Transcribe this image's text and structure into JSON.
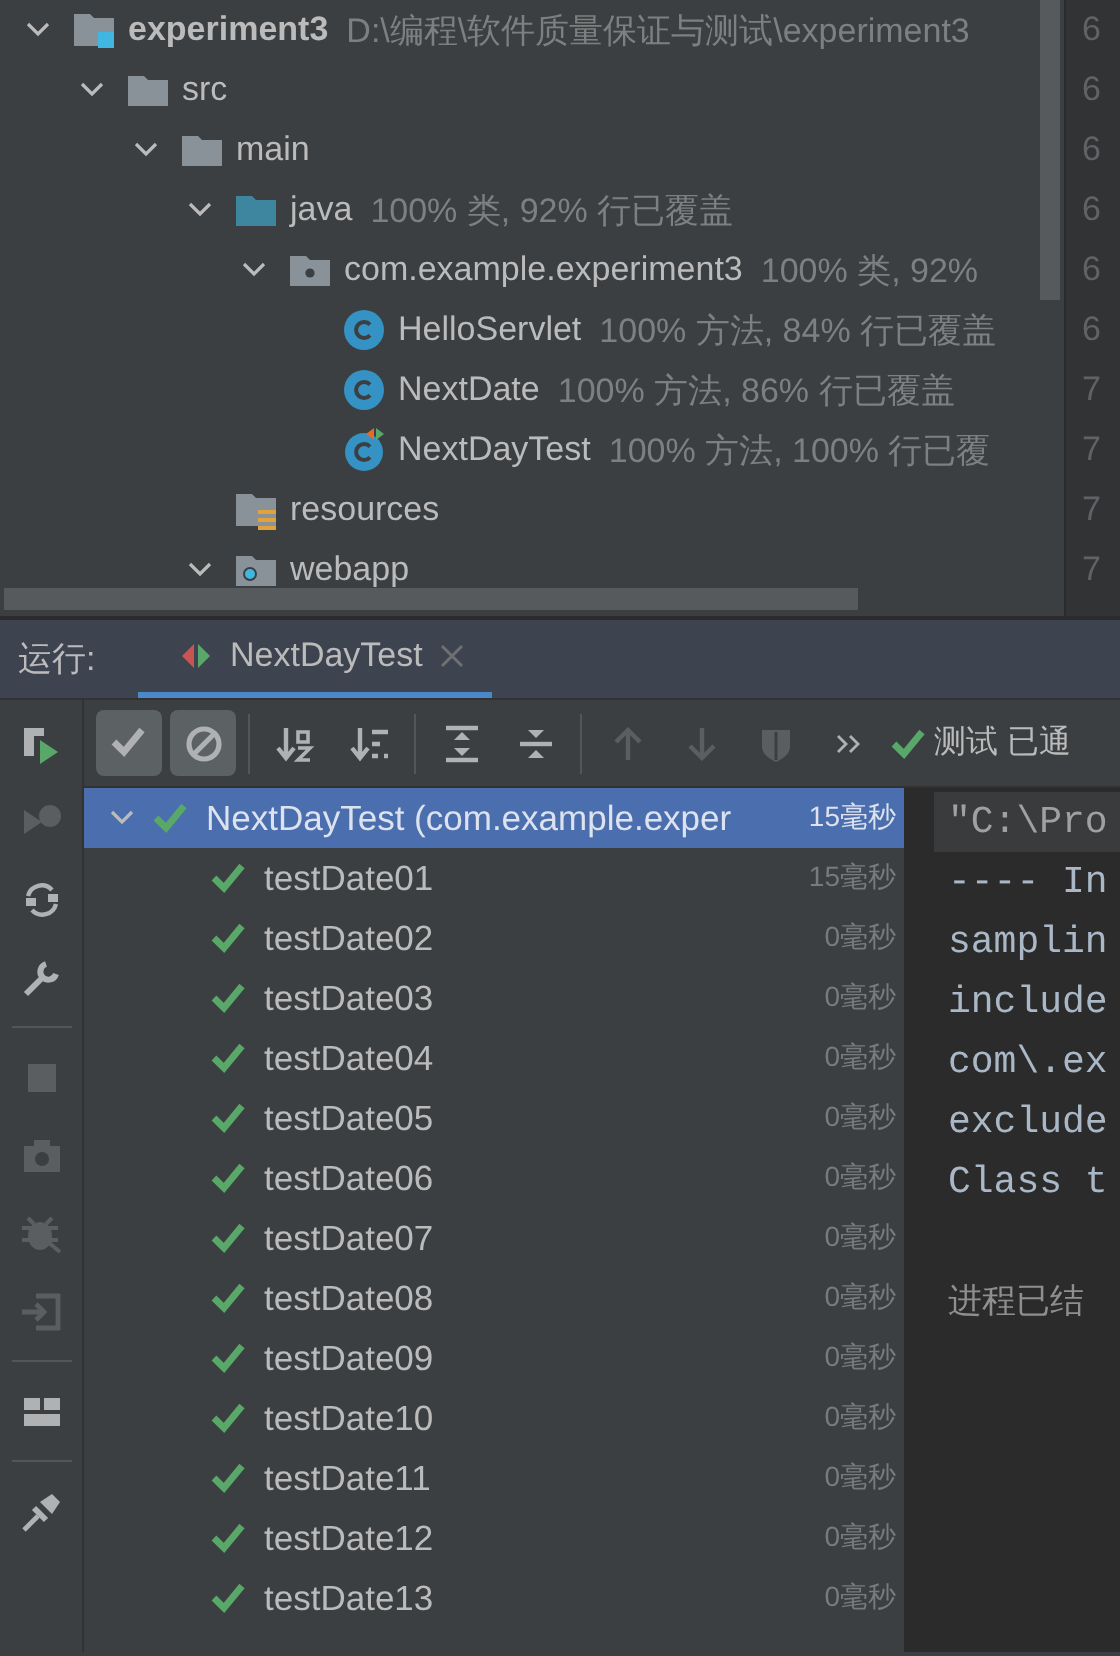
{
  "project_tree": {
    "items": [
      {
        "label": "experiment3",
        "detail": "D:\\编程\\软件质量保证与测试\\experiment3",
        "kind": "module",
        "expanded": true,
        "children": [
          {
            "label": "src",
            "kind": "folder",
            "expanded": true,
            "children": [
              {
                "label": "main",
                "kind": "folder",
                "expanded": true,
                "children": [
                  {
                    "label": "java",
                    "detail": "100% 类, 92% 行已覆盖",
                    "kind": "source-folder",
                    "expanded": true,
                    "children": [
                      {
                        "label": "com.example.experiment3",
                        "detail": "100% 类, 92%",
                        "kind": "package",
                        "expanded": true,
                        "children": [
                          {
                            "label": "HelloServlet",
                            "detail": "100% 方法, 84% 行已覆盖",
                            "kind": "class"
                          },
                          {
                            "label": "NextDate",
                            "detail": "100% 方法, 86% 行已覆盖",
                            "kind": "class"
                          },
                          {
                            "label": "NextDayTest",
                            "detail": "100% 方法, 100% 行已覆",
                            "kind": "test-class"
                          }
                        ]
                      }
                    ]
                  },
                  {
                    "label": "resources",
                    "kind": "resources-folder"
                  },
                  {
                    "label": "webapp",
                    "kind": "web-folder",
                    "expanded": true
                  }
                ]
              }
            ]
          }
        ]
      }
    ],
    "line_numbers": [
      "6",
      "6",
      "6",
      "6",
      "6",
      "6",
      "7",
      "7",
      "7",
      "7"
    ]
  },
  "run_panel": {
    "label": "运行:",
    "tabs": [
      {
        "label": "NextDayTest",
        "selected": true
      }
    ],
    "side_tools": [
      {
        "kind": "rerun",
        "disabled": false
      },
      {
        "kind": "rerun-failed",
        "disabled": true
      },
      {
        "kind": "auto-rerun",
        "disabled": false
      },
      {
        "kind": "settings",
        "disabled": false
      },
      {
        "kind": "divider"
      },
      {
        "kind": "stop",
        "disabled": true
      },
      {
        "kind": "camera",
        "disabled": true
      },
      {
        "kind": "debug",
        "disabled": true
      },
      {
        "kind": "exit",
        "disabled": true
      },
      {
        "kind": "divider"
      },
      {
        "kind": "layout",
        "disabled": false
      },
      {
        "kind": "divider"
      },
      {
        "kind": "pin",
        "disabled": false
      }
    ],
    "toolbar": [
      {
        "kind": "show-passed",
        "on": true
      },
      {
        "kind": "show-ignored",
        "on": true
      },
      {
        "kind": "divider"
      },
      {
        "kind": "sort-alpha",
        "on": false
      },
      {
        "kind": "sort-duration",
        "on": false
      },
      {
        "kind": "divider"
      },
      {
        "kind": "expand-all",
        "on": false
      },
      {
        "kind": "collapse-all",
        "on": false
      },
      {
        "kind": "divider"
      },
      {
        "kind": "previous",
        "disabled": true
      },
      {
        "kind": "next",
        "disabled": true
      },
      {
        "kind": "coverage",
        "disabled": true
      },
      {
        "kind": "more"
      }
    ],
    "status": "测试 已通",
    "tests": [
      {
        "label": "NextDayTest (com.example.exper",
        "time": "15毫秒",
        "passed": true,
        "selected": true,
        "expanded": true,
        "children": [
          {
            "label": "testDate01",
            "time": "15毫秒",
            "passed": true,
            "selected": false
          },
          {
            "label": "testDate02",
            "time": "0毫秒",
            "passed": true,
            "selected": false
          },
          {
            "label": "testDate03",
            "time": "0毫秒",
            "passed": true,
            "selected": false
          },
          {
            "label": "testDate04",
            "time": "0毫秒",
            "passed": true,
            "selected": false
          },
          {
            "label": "testDate05",
            "time": "0毫秒",
            "passed": true,
            "selected": false
          },
          {
            "label": "testDate06",
            "time": "0毫秒",
            "passed": true,
            "selected": false
          },
          {
            "label": "testDate07",
            "time": "0毫秒",
            "passed": true,
            "selected": false
          },
          {
            "label": "testDate08",
            "time": "0毫秒",
            "passed": true,
            "selected": false
          },
          {
            "label": "testDate09",
            "time": "0毫秒",
            "passed": true,
            "selected": false
          },
          {
            "label": "testDate10",
            "time": "0毫秒",
            "passed": true,
            "selected": false
          },
          {
            "label": "testDate11",
            "time": "0毫秒",
            "passed": true,
            "selected": false
          },
          {
            "label": "testDate12",
            "time": "0毫秒",
            "passed": true,
            "selected": false
          },
          {
            "label": "testDate13",
            "time": "0毫秒",
            "passed": true,
            "selected": false
          }
        ]
      }
    ],
    "console": [
      {
        "kind": "command",
        "text": "\"C:\\Pro"
      },
      {
        "kind": "output",
        "text": "---- In"
      },
      {
        "kind": "output",
        "text": "samplin"
      },
      {
        "kind": "output",
        "text": "include"
      },
      {
        "kind": "output",
        "text": "com\\.ex"
      },
      {
        "kind": "output",
        "text": "exclude"
      },
      {
        "kind": "output",
        "text": "Class t"
      },
      {
        "kind": "status",
        "text": "进程已结"
      }
    ]
  }
}
